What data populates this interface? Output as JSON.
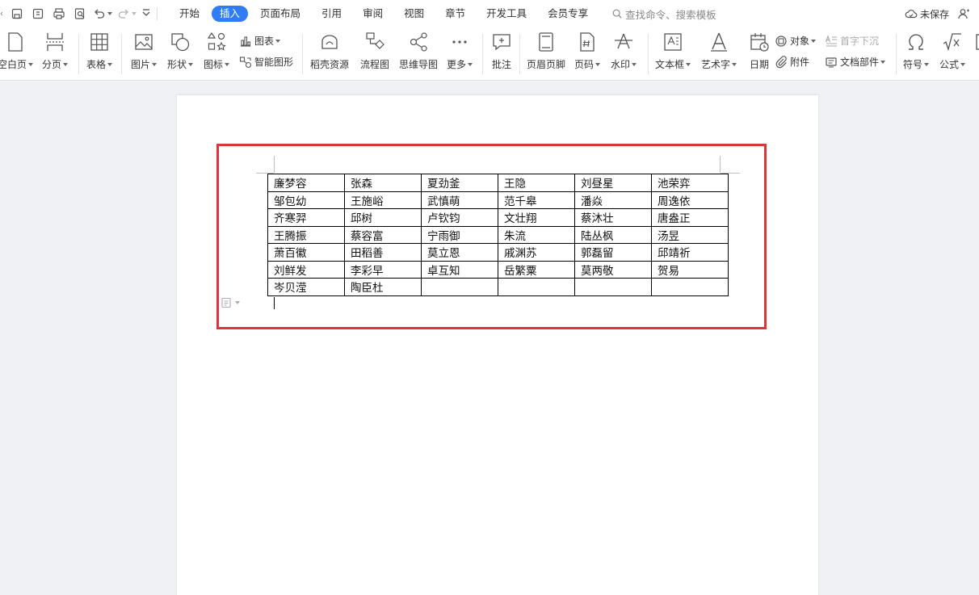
{
  "menu": {
    "quick_access_icons": [
      "chevron-left-icon",
      "save-icon",
      "export-pdf-icon",
      "print-icon",
      "print-preview-icon",
      "undo-icon",
      "redo-icon",
      "customize-icon"
    ],
    "tabs": [
      "开始",
      "插入",
      "页面布局",
      "引用",
      "审阅",
      "视图",
      "章节",
      "开发工具",
      "会员专享"
    ],
    "active_tab": "插入",
    "search_placeholder": "查找命令、搜索模板",
    "save_status": "未保存"
  },
  "ribbon": {
    "blank_page": "空白页",
    "page_break": "分页",
    "table": "表格",
    "picture": "图片",
    "shape": "形状",
    "icons": "图标",
    "chart": "图表",
    "smart_art": "智能图形",
    "docer_resources": "稻壳资源",
    "flowchart": "流程图",
    "mind_map": "思维导图",
    "more": "更多",
    "comment": "批注",
    "header_footer": "页眉页脚",
    "page_number": "页码",
    "watermark": "水印",
    "text_box": "文本框",
    "word_art": "艺术字",
    "date": "日期",
    "object": "对象",
    "drop_cap": "首字下沉",
    "attachment": "附件",
    "doc_parts": "文档部件",
    "symbol": "符号",
    "formula": "公式"
  },
  "document": {
    "table_rows": [
      [
        "廉梦容",
        "张森",
        "夏劲釜",
        "王隐",
        "刘昼星",
        "池荣弈"
      ],
      [
        "邹包幼",
        "王施峪",
        "武慎萌",
        "范千皋",
        "潘焱",
        "周逸依"
      ],
      [
        "齐寒羿",
        "邱树",
        "卢钦钧",
        "文壮翔",
        "蔡沐壮",
        "唐盎正"
      ],
      [
        "王腾振",
        "蔡容富",
        "宁雨御",
        "朱流",
        "陆丛枫",
        "汤昱"
      ],
      [
        "萧百徽",
        "田稻善",
        "莫立恩",
        "戚渊苏",
        "郭磊留",
        "邱靖祈"
      ],
      [
        "刘鲜发",
        "李彩早",
        "卓互知",
        "岳繁粟",
        "莫两敬",
        "贺易"
      ],
      [
        "岑贝滢",
        "陶臣杜",
        "",
        "",
        "",
        ""
      ]
    ]
  },
  "colors": {
    "accent": "#2f7cf6",
    "highlight_border": "#d9363e",
    "workspace_bg": "#f0f1f4"
  }
}
